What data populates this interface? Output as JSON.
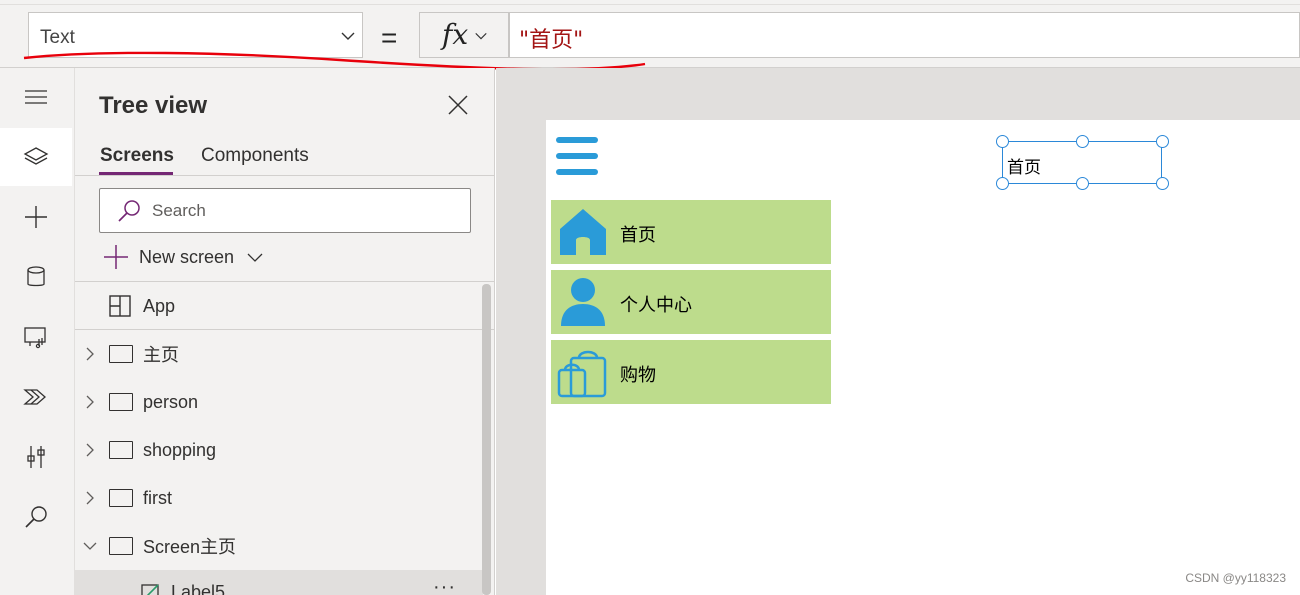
{
  "formula_bar": {
    "property": "Text",
    "equals": "=",
    "fx_label": "fx",
    "formula": "\"首页\""
  },
  "rail": {
    "items": [
      "menu-icon",
      "layers-icon",
      "plus-icon",
      "database-icon",
      "media-icon",
      "power-automate-icon",
      "tools-icon",
      "search-icon"
    ]
  },
  "tree_view": {
    "title": "Tree view",
    "tabs": [
      "Screens",
      "Components"
    ],
    "search_placeholder": "Search",
    "new_screen_label": "New screen",
    "app_label": "App",
    "screens": [
      "主页",
      "person",
      "shopping",
      "first",
      "Screen主页"
    ],
    "child": "Label5"
  },
  "canvas": {
    "menu_items": [
      "首页",
      "个人中心",
      "购物"
    ],
    "selected_label_text": "首页"
  },
  "watermark": "CSDN @yy118323",
  "colors": {
    "accent_purple": "#742774",
    "menu_green": "#bddc8c",
    "icon_blue": "#2a9bd8",
    "formula_red": "#a31515"
  }
}
